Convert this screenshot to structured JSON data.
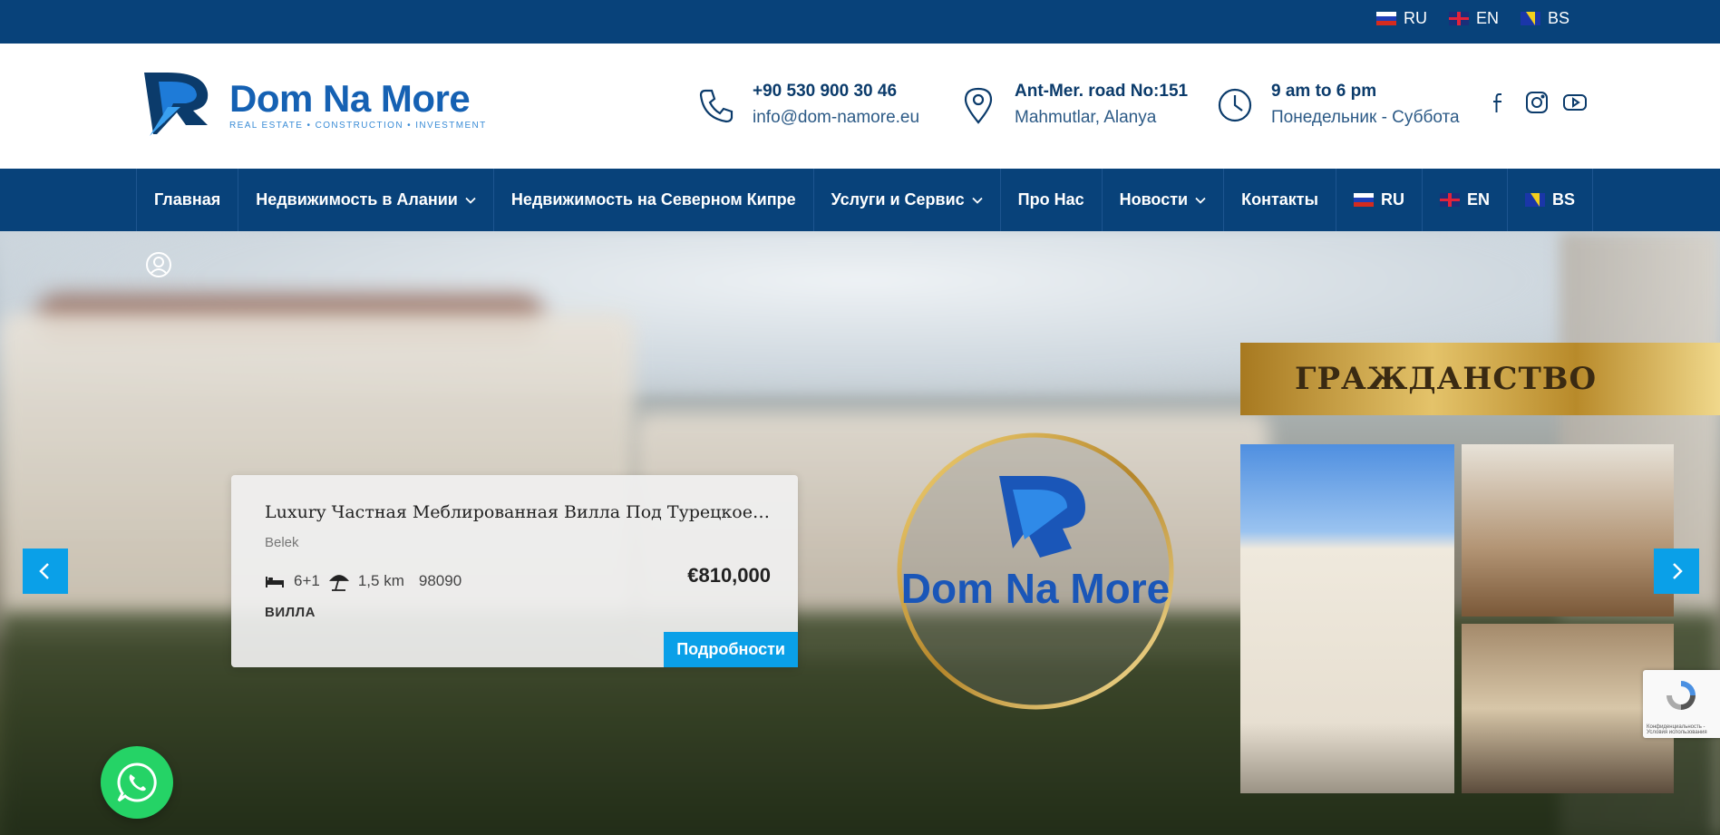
{
  "topbar": {
    "languages": [
      {
        "code": "RU",
        "flag": "ru-flag-icon"
      },
      {
        "code": "EN",
        "flag": "uk-flag-icon"
      },
      {
        "code": "BS",
        "flag": "bosnia-flag-icon"
      }
    ]
  },
  "header": {
    "logo": {
      "name": "Dom Na More",
      "tagline": "REAL ESTATE • CONSTRUCTION • INVESTMENT"
    },
    "phone": {
      "line1": "+90 530 900 30 46",
      "line2": "info@dom-namore.eu"
    },
    "address": {
      "line1": "Ant-Mer. road No:151",
      "line2": "Mahmutlar, Alanya"
    },
    "hours": {
      "line1": "9 am to 6 pm",
      "line2": "Понедельник - Суббота"
    }
  },
  "nav": {
    "items": [
      {
        "label": "Главная"
      },
      {
        "label": "Недвижимость в Алании"
      },
      {
        "label": "Недвижимость на Северном Кипре"
      },
      {
        "label": "Услуги и Сервис"
      },
      {
        "label": "Про Нас"
      },
      {
        "label": "Новости"
      },
      {
        "label": "Контакты"
      },
      {
        "label": "RU"
      },
      {
        "label": "EN"
      },
      {
        "label": "BS"
      }
    ]
  },
  "slide": {
    "title": "Luxury Частная Меблированная Вилла Под Турецкое Г...",
    "location": "Belek",
    "rooms": "6+1",
    "beach_distance": "1,5 km",
    "ref": "98090",
    "price": "€810,000",
    "type": "ВИЛЛА",
    "details_label": "Подробности"
  },
  "circle_logo": {
    "name": "Dom Na More"
  },
  "promo": {
    "banner": "ГРАЖДАНСТВО"
  },
  "recaptcha": {
    "text": "Конфиденциальность - Условия использования"
  },
  "colors": {
    "navy": "#08427a",
    "accent": "#0aa0e8",
    "whatsapp": "#25d366"
  }
}
